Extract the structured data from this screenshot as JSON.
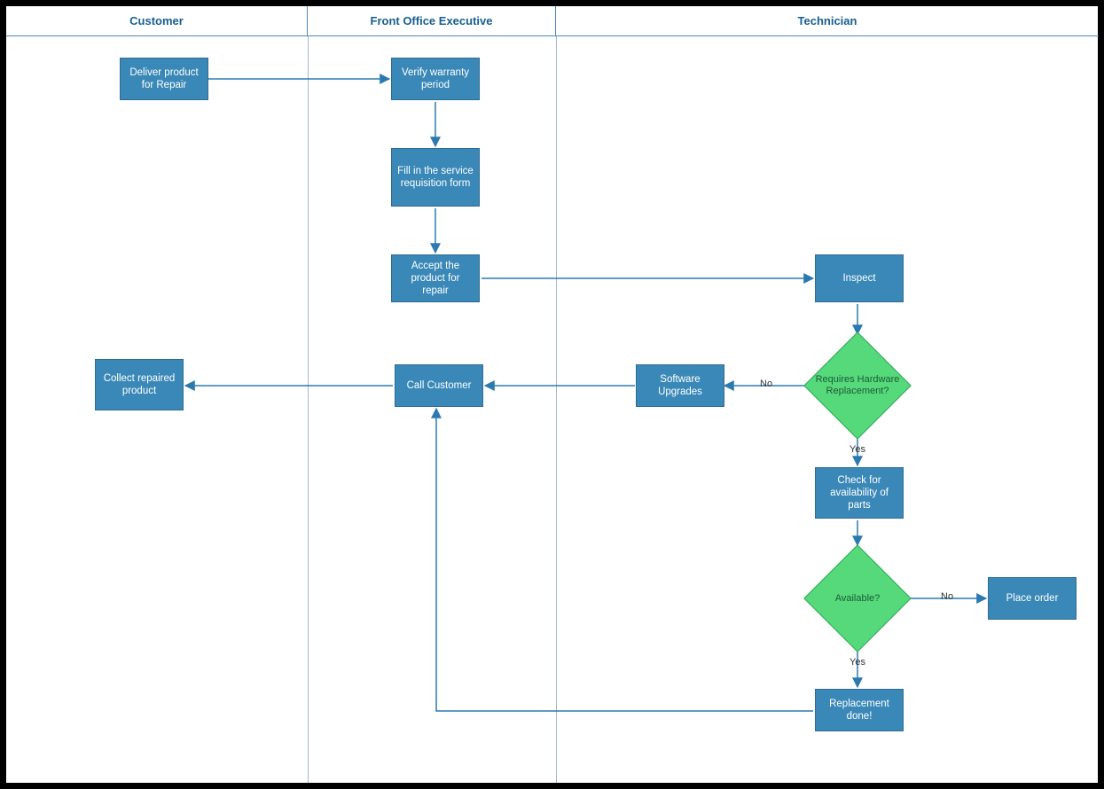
{
  "lanes": {
    "customer": "Customer",
    "frontOffice": "Front Office Executive",
    "technician": "Technician"
  },
  "nodes": {
    "deliver": {
      "text": "Deliver product for Repair"
    },
    "verify": {
      "text": "Verify warranty period"
    },
    "fillForm": {
      "text": "Fill in the service requisition form"
    },
    "accept": {
      "text": "Accept the product for repair"
    },
    "inspect": {
      "text": "Inspect"
    },
    "reqHardware": {
      "text": "Requires Hardware Replacement?"
    },
    "software": {
      "text": "Software Upgrades"
    },
    "callCustomer": {
      "text": "Call Customer"
    },
    "collect": {
      "text": "Collect repaired product"
    },
    "checkParts": {
      "text": "Check for availability of parts"
    },
    "available": {
      "text": "Available?"
    },
    "placeOrder": {
      "text": "Place order"
    },
    "replacement": {
      "text": "Replacement done!"
    }
  },
  "edgeLabels": {
    "hwNo": "No",
    "hwYes": "Yes",
    "avNo": "No",
    "avYes": "Yes"
  },
  "colors": {
    "process": "#3a88b7",
    "decision": "#56d97a",
    "laneHeader": "#175f8f",
    "arrow": "#2a7ab0"
  }
}
